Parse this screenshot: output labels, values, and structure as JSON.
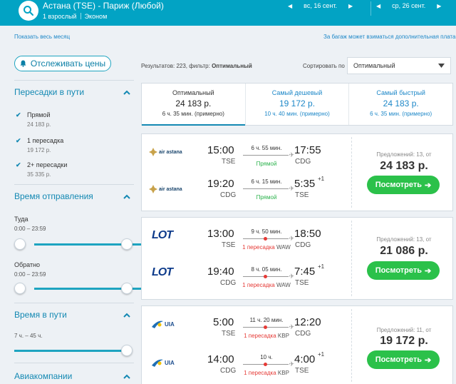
{
  "header": {
    "route": "Астана (TSE) - Париж (Любой)",
    "passengers": "1 взрослый",
    "cabin": "Эконом",
    "depart_date": "вс, 16 сент.",
    "return_date": "ср, 26 сент."
  },
  "links": {
    "show_month": "Показать весь месяц",
    "baggage_note": "За багаж может взиматься дополнительная плата"
  },
  "track_button": "Отслеживать цены",
  "results": {
    "prefix": "Результатов: 223, фильтр: ",
    "filter": "Оптимальный"
  },
  "sort": {
    "label": "Сортировать по",
    "value": "Оптимальный"
  },
  "filters": {
    "stops": {
      "title": "Пересадки в пути",
      "options": [
        {
          "label": "Прямой",
          "price": "24 183 р."
        },
        {
          "label": "1 пересадка",
          "price": "19 172 р."
        },
        {
          "label": "2+ пересадки",
          "price": "35 335 р."
        }
      ]
    },
    "departure": {
      "title": "Время отправления",
      "outbound_label": "Туда",
      "outbound_range": "0:00 – 23:59",
      "return_label": "Обратно",
      "return_range": "0:00 – 23:59"
    },
    "duration": {
      "title": "Время в пути",
      "range": "7 ч. – 45 ч."
    },
    "airlines": {
      "title": "Авиакомпании"
    }
  },
  "tabs": [
    {
      "title": "Оптимальный",
      "price": "24 183 р.",
      "duration": "6 ч. 35 мин. (примерно)"
    },
    {
      "title": "Самый дешевый",
      "price": "19 172 р.",
      "duration": "10 ч. 40 мин. (примерно)"
    },
    {
      "title": "Самый быстрый",
      "price": "24 183 р.",
      "duration": "6 ч. 35 мин. (примерно)"
    }
  ],
  "button_label": "Посмотреть",
  "offers": [
    {
      "offers_text": "Предложений: 13, от",
      "price": "24 183 р.",
      "legs": [
        {
          "airline": "air astana",
          "dep_time": "15:00",
          "dep_airport": "TSE",
          "duration": "6 ч. 55 мин.",
          "stops": "Прямой",
          "via": "",
          "arr_time": "17:55",
          "arr_airport": "CDG",
          "plus": ""
        },
        {
          "airline": "air astana",
          "dep_time": "19:20",
          "dep_airport": "CDG",
          "duration": "6 ч. 15 мин.",
          "stops": "Прямой",
          "via": "",
          "arr_time": "5:35",
          "arr_airport": "TSE",
          "plus": "+1"
        }
      ]
    },
    {
      "offers_text": "Предложений: 13, от",
      "price": "21 086 р.",
      "legs": [
        {
          "airline": "LOT",
          "dep_time": "13:00",
          "dep_airport": "TSE",
          "duration": "9 ч. 50 мин.",
          "stops": "1 пересадка",
          "via": "WAW",
          "arr_time": "18:50",
          "arr_airport": "CDG",
          "plus": ""
        },
        {
          "airline": "LOT",
          "dep_time": "19:40",
          "dep_airport": "CDG",
          "duration": "8 ч. 05 мин.",
          "stops": "1 пересадка",
          "via": "WAW",
          "arr_time": "7:45",
          "arr_airport": "TSE",
          "plus": "+1"
        }
      ]
    },
    {
      "offers_text": "Предложений: 11, от",
      "price": "19 172 р.",
      "legs": [
        {
          "airline": "UIA",
          "dep_time": "5:00",
          "dep_airport": "TSE",
          "duration": "11 ч. 20 мин.",
          "stops": "1 пересадка",
          "via": "KBP",
          "arr_time": "12:20",
          "arr_airport": "CDG",
          "plus": ""
        },
        {
          "airline": "UIA",
          "dep_time": "14:00",
          "dep_airport": "CDG",
          "duration": "10 ч.",
          "stops": "1 пересадка",
          "via": "KBP",
          "arr_time": "4:00",
          "arr_airport": "TSE",
          "plus": "+1"
        }
      ]
    }
  ],
  "colors": {
    "header_bg": "#02a3c4",
    "accent": "#1489b3",
    "button_green": "#2bc14a",
    "stop_red": "#e53935",
    "direct_green": "#2bb24c"
  }
}
